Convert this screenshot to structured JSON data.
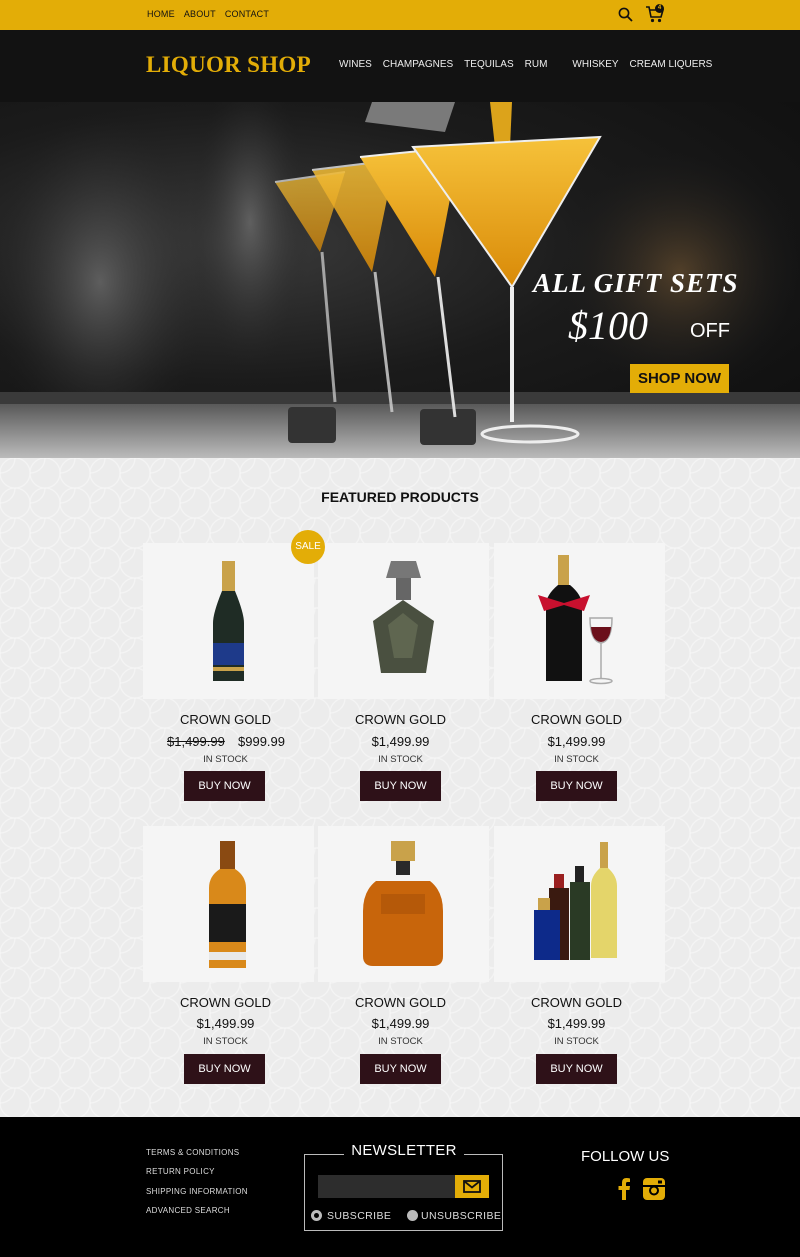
{
  "topbar": {
    "nav": [
      "HOME",
      "ABOUT",
      "CONTACT"
    ],
    "cart_count": "4"
  },
  "header": {
    "logo": "LIQUOR SHOP",
    "nav": [
      "WINES",
      "CHAMPAGNES",
      "TEQUILAS",
      "RUM",
      "WHISKEY",
      "CREAM LIQUERS"
    ]
  },
  "hero": {
    "line1": "ALL GIFT SETS",
    "price": "$100",
    "off": "OFF",
    "cta": "SHOP NOW"
  },
  "featured": {
    "title": "FEATURED PRODUCTS",
    "sale_badge": "SALE",
    "products": [
      {
        "name": "CROWN GOLD",
        "old_price": "$1,499.99",
        "price": "$999.99",
        "stock": "IN STOCK",
        "button": "BUY NOW"
      },
      {
        "name": "CROWN GOLD",
        "price": "$1,499.99",
        "stock": "IN STOCK",
        "button": "BUY NOW"
      },
      {
        "name": "CROWN GOLD",
        "price": "$1,499.99",
        "stock": "IN STOCK",
        "button": "BUY NOW"
      },
      {
        "name": "CROWN GOLD",
        "price": "$1,499.99",
        "stock": "IN STOCK",
        "button": "BUY NOW"
      },
      {
        "name": "CROWN GOLD",
        "price": "$1,499.99",
        "stock": "IN STOCK",
        "button": "BUY NOW"
      },
      {
        "name": "CROWN GOLD",
        "price": "$1,499.99",
        "stock": "IN STOCK",
        "button": "BUY NOW"
      }
    ]
  },
  "footer": {
    "links": [
      "TERMS & CONDITIONS",
      "RETURN POLICY",
      "SHIPPING INFORMATION",
      "ADVANCED SEARCH"
    ],
    "newsletter": {
      "title": "NEWSLETTER",
      "email_value": "",
      "subscribe": "SUBSCRIBE",
      "unsubscribe": "UNSUBSCRIBE",
      "selected": "subscribe"
    },
    "follow": "FOLLOW US",
    "social_icons": [
      "facebook-icon",
      "instagram-icon"
    ]
  },
  "colors": {
    "accent": "#e3ad07",
    "header_bg": "#121212",
    "button_bg": "#2e1118",
    "footer_bg": "#000000"
  }
}
